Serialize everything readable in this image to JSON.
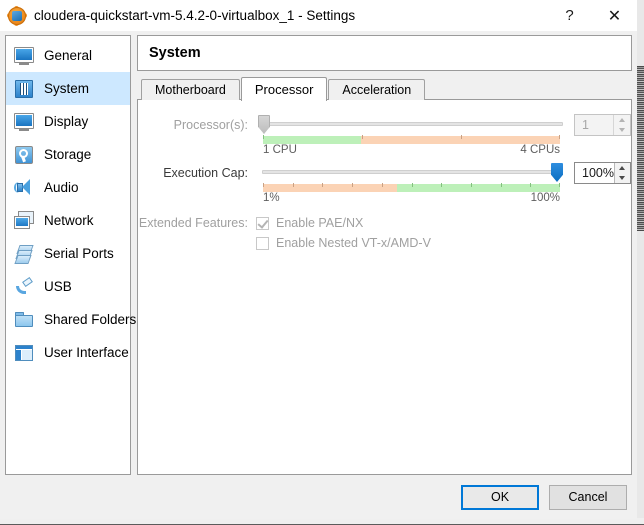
{
  "window": {
    "title": "cloudera-quickstart-vm-5.4.2-0-virtualbox_1 - Settings",
    "icon": "virtualbox-icon",
    "help_label": "?",
    "close_label": "✕"
  },
  "sidebar": {
    "items": [
      {
        "label": "General",
        "icon": "general-icon",
        "selected": false
      },
      {
        "label": "System",
        "icon": "system-icon",
        "selected": true
      },
      {
        "label": "Display",
        "icon": "display-icon",
        "selected": false
      },
      {
        "label": "Storage",
        "icon": "storage-icon",
        "selected": false
      },
      {
        "label": "Audio",
        "icon": "audio-icon",
        "selected": false
      },
      {
        "label": "Network",
        "icon": "network-icon",
        "selected": false
      },
      {
        "label": "Serial Ports",
        "icon": "serial-ports-icon",
        "selected": false
      },
      {
        "label": "USB",
        "icon": "usb-icon",
        "selected": false
      },
      {
        "label": "Shared Folders",
        "icon": "shared-folders-icon",
        "selected": false
      },
      {
        "label": "User Interface",
        "icon": "user-interface-icon",
        "selected": false
      }
    ]
  },
  "panel": {
    "title": "System",
    "tabs": [
      {
        "label": "Motherboard",
        "active": false
      },
      {
        "label": "Processor",
        "active": true
      },
      {
        "label": "Acceleration",
        "active": false
      }
    ]
  },
  "processor_tab": {
    "processors": {
      "label": "Processor(s):",
      "value": "1",
      "min_label": "1 CPU",
      "max_label": "4 CPUs",
      "handle_percent": 0,
      "green_percent": 33,
      "disabled": true
    },
    "execution_cap": {
      "label": "Execution Cap:",
      "value": "100%",
      "min_label": "1%",
      "max_label": "100%",
      "handle_percent": 100,
      "orange_percent": 45,
      "disabled": false
    },
    "extended_features": {
      "label": "Extended Features:",
      "options": [
        {
          "label": "Enable PAE/NX",
          "checked": true,
          "disabled": true
        },
        {
          "label": "Enable Nested VT-x/AMD-V",
          "checked": false,
          "disabled": true
        }
      ]
    }
  },
  "footer": {
    "ok_label": "OK",
    "cancel_label": "Cancel"
  },
  "colors": {
    "accent": "#0078d7",
    "selection": "#cde8ff",
    "scale_green": "#bdf0b9",
    "scale_orange": "#fbd3b5",
    "slider_blue": "#0a6ec0"
  }
}
